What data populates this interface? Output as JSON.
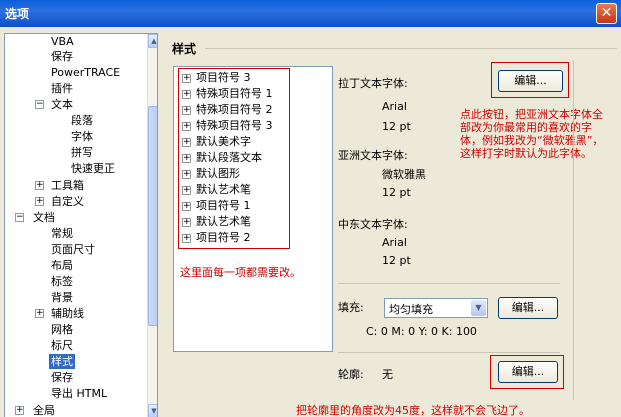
{
  "window": {
    "title": "选项",
    "close_symbol": "✕"
  },
  "tree": {
    "items": [
      {
        "label": "VBA"
      },
      {
        "label": "保存"
      },
      {
        "label": "PowerTRACE"
      },
      {
        "label": "插件"
      },
      {
        "label": "文本"
      },
      {
        "label": "段落"
      },
      {
        "label": "字体"
      },
      {
        "label": "拼写"
      },
      {
        "label": "快速更正"
      },
      {
        "label": "工具箱"
      },
      {
        "label": "自定义"
      },
      {
        "label": "文档"
      },
      {
        "label": "常规"
      },
      {
        "label": "页面尺寸"
      },
      {
        "label": "布局"
      },
      {
        "label": "标签"
      },
      {
        "label": "背景"
      },
      {
        "label": "辅助线"
      },
      {
        "label": "网格"
      },
      {
        "label": "标尺"
      },
      {
        "label": "样式"
      },
      {
        "label": "保存"
      },
      {
        "label": "导出 HTML"
      },
      {
        "label": "全局"
      }
    ],
    "expand_open": "−",
    "expand_closed": "+",
    "scroll_up": "▲",
    "scroll_down": "▼"
  },
  "panel": {
    "title": "样式",
    "styles": [
      "项目符号 3",
      "特殊项目符号 1",
      "特殊项目符号 2",
      "特殊项目符号 3",
      "默认美术字",
      "默认段落文本",
      "默认图形",
      "默认艺术笔",
      "项目符号 1",
      "默认艺术笔",
      "项目符号 2"
    ],
    "latin_font_label": "拉丁文本字体:",
    "latin_font_name": "Arial",
    "latin_font_size": "12 pt",
    "asian_font_label": "亚洲文本字体:",
    "asian_font_name": "微软雅黑",
    "asian_font_size": "12 pt",
    "me_font_label": "中东文本字体:",
    "me_font_name": "Arial",
    "me_font_size": "12 pt",
    "edit_label": "编辑...",
    "fill_label": "填充:",
    "fill_value": "均匀填充",
    "fill_color": "C: 0 M: 0 Y: 0 K: 100",
    "outline_label": "轮廓:",
    "outline_value": "无"
  },
  "annotations": {
    "font_note": "点此按钮，把亚洲文本字体全部改为你最常用的喜欢的字体，例如我改为“微软雅黑”，这样打字时默认为此字体。",
    "list_note": "这里面每一项都需要改。",
    "outline_note": "把轮廓里的角度改为45度，这样就不会飞边了。",
    "color": "#d00000"
  }
}
